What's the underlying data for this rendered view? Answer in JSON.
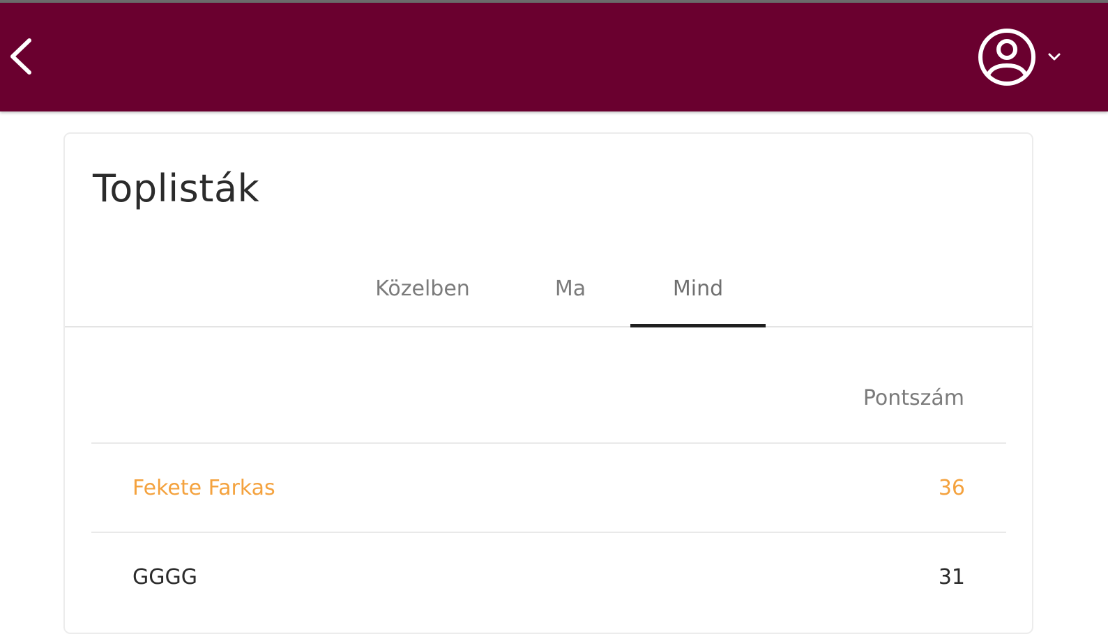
{
  "colors": {
    "header_bg": "#6a002f",
    "highlight": "#f4a23e",
    "tab_indicator": "#1f1f1f"
  },
  "header": {
    "back_icon": "chevron-left-icon",
    "account_icon": "account-circle-icon",
    "account_menu_icon": "chevron-down-icon"
  },
  "card": {
    "title": "Toplisták"
  },
  "tabs": [
    {
      "label": "Közelben",
      "active": false
    },
    {
      "label": "Ma",
      "active": false
    },
    {
      "label": "Mind",
      "active": true
    }
  ],
  "leaderboard": {
    "column_header": "Pontszám",
    "rows": [
      {
        "name": "Fekete Farkas",
        "score": "36",
        "current_user": true
      },
      {
        "name": "GGGG",
        "score": "31",
        "current_user": false
      }
    ]
  }
}
